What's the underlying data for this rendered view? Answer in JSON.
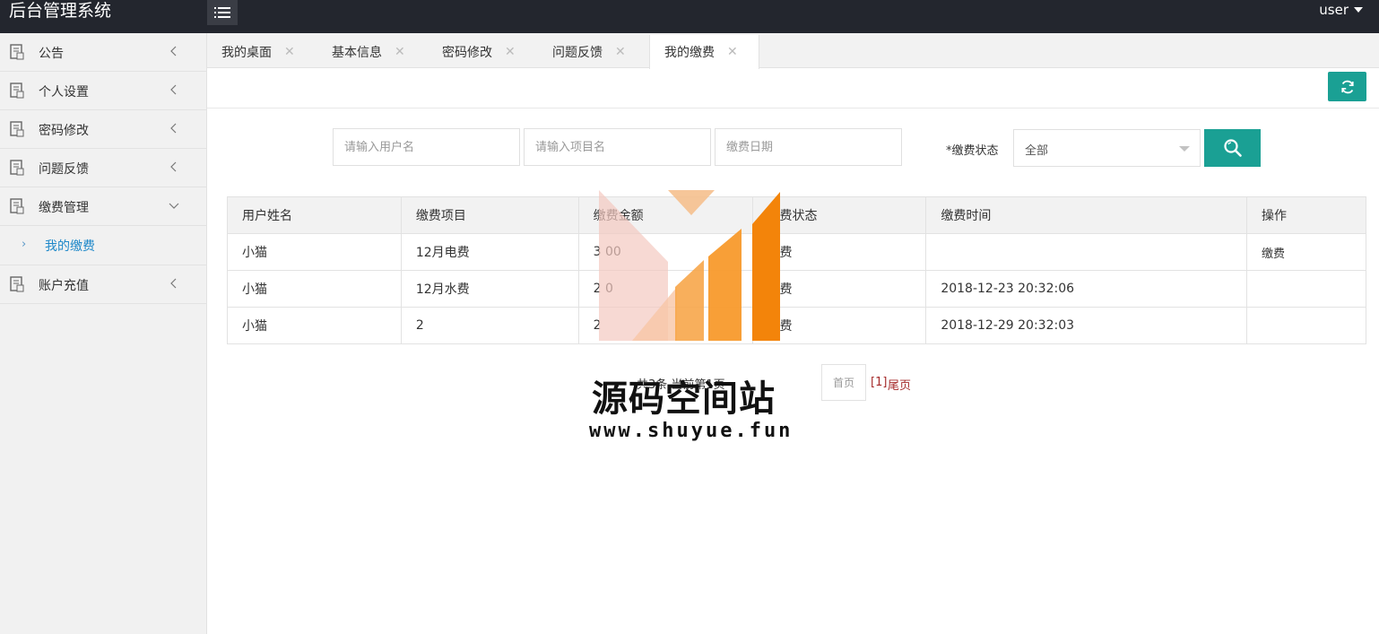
{
  "app": {
    "title": "后台管理系统",
    "user": "user"
  },
  "sidebar": {
    "items": [
      {
        "label": "公告"
      },
      {
        "label": "个人设置"
      },
      {
        "label": "密码修改"
      },
      {
        "label": "问题反馈"
      },
      {
        "label": "缴费管理"
      },
      {
        "label": "账户充值"
      }
    ],
    "sub_item": {
      "label": "我的缴费"
    }
  },
  "tabs": [
    {
      "label": "我的桌面"
    },
    {
      "label": "基本信息"
    },
    {
      "label": "密码修改"
    },
    {
      "label": "问题反馈"
    },
    {
      "label": "我的缴费",
      "active": true
    }
  ],
  "search": {
    "username_placeholder": "请输入用户名",
    "project_placeholder": "请输入项目名",
    "date_placeholder": "缴费日期",
    "status_label": "*缴费状态",
    "status_value": "全部"
  },
  "table": {
    "headers": [
      "用户姓名",
      "缴费项目",
      "缴费金额",
      "缴费状态",
      "缴费时间",
      "操作"
    ],
    "rows": [
      [
        "小猫",
        "12月电费",
        "3  00",
        "缴费",
        "",
        "缴费"
      ],
      [
        "小猫",
        "12月水费",
        "2   0",
        "缴费",
        "2018-12-23 20:32:06",
        ""
      ],
      [
        "小猫",
        "2",
        "2",
        "缴费",
        "2018-12-29 20:32:03",
        ""
      ]
    ]
  },
  "pager": {
    "info": "共3条 当前第1页",
    "first": "首页",
    "current": "[1]",
    "last": "尾页"
  },
  "watermark": {
    "title": "源码空间站",
    "url": "www.shuyue.fun"
  },
  "colors": {
    "accent": "#1aa094",
    "topbar": "#23262e",
    "link": "#1e88c9"
  }
}
